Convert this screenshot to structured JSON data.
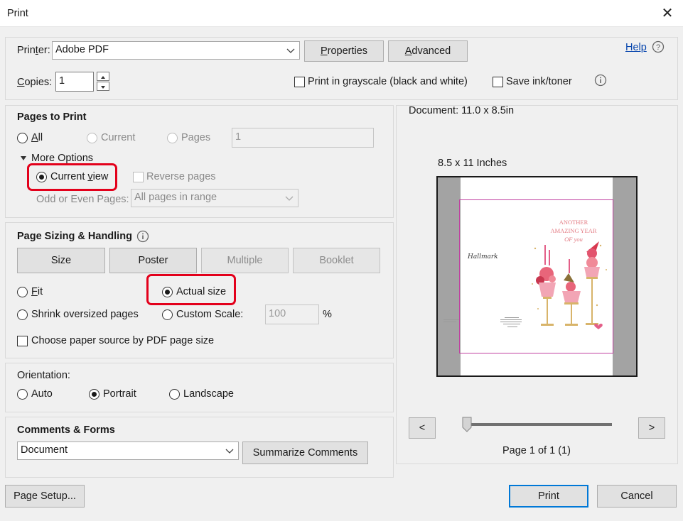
{
  "window": {
    "title": "Print"
  },
  "printer": {
    "label_pre": "Prin",
    "label_key": "t",
    "label_post": "er:",
    "value": "Adobe PDF",
    "properties_key": "P",
    "properties_rest": "roperties",
    "advanced_key": "A",
    "advanced_rest": "dvanced"
  },
  "help": {
    "label": "Help"
  },
  "copies": {
    "label_key": "C",
    "label_rest": "opies:",
    "value": "1"
  },
  "options": {
    "grayscale_label": "Print in grayscale (black and white)",
    "save_ink_label": "Save ink/toner"
  },
  "pages_to_print": {
    "heading": "Pages to Print",
    "all_key": "A",
    "all_rest": "ll",
    "current": "Current",
    "pages": "Pages",
    "pages_value": "1",
    "more_options": "More Options",
    "current_view_pre": "Current ",
    "current_view_key": "v",
    "current_view_post": "iew",
    "reverse_pages": "Reverse pages",
    "odd_even_label": "Odd or Even Pages:",
    "odd_even_value": "All pages in range"
  },
  "sizing": {
    "heading": "Page Sizing & Handling",
    "tabs": [
      "Size",
      "Poster",
      "Multiple",
      "Booklet"
    ],
    "fit_key": "F",
    "fit_rest": "it",
    "actual_size": "Actual size",
    "shrink": "Shrink oversized pages",
    "custom_scale": "Custom Scale:",
    "scale_value": "100",
    "percent": "%",
    "paper_source": "Choose paper source by PDF page size"
  },
  "orientation": {
    "heading": "Orientation:",
    "auto": "Auto",
    "portrait": "Portrait",
    "landscape": "Landscape"
  },
  "comments": {
    "heading": "Comments & Forms",
    "value": "Document",
    "summarize": "Summarize Comments"
  },
  "preview": {
    "document_size": "Document: 11.0 x 8.5in",
    "paper_size": "8.5 x 11 Inches",
    "prev": "<",
    "next": ">",
    "page_indicator": "Page 1 of 1 (1)",
    "card": {
      "brand": "Hallmark",
      "line1": "ANOTHER",
      "line2": "AMAZING YEAR",
      "line3": "OF you"
    }
  },
  "footer": {
    "page_setup": "Page Setup...",
    "print": "Print",
    "cancel": "Cancel"
  },
  "colors": {
    "highlight": "#e3001b",
    "focus": "#0078d7",
    "link": "#0645ad"
  }
}
